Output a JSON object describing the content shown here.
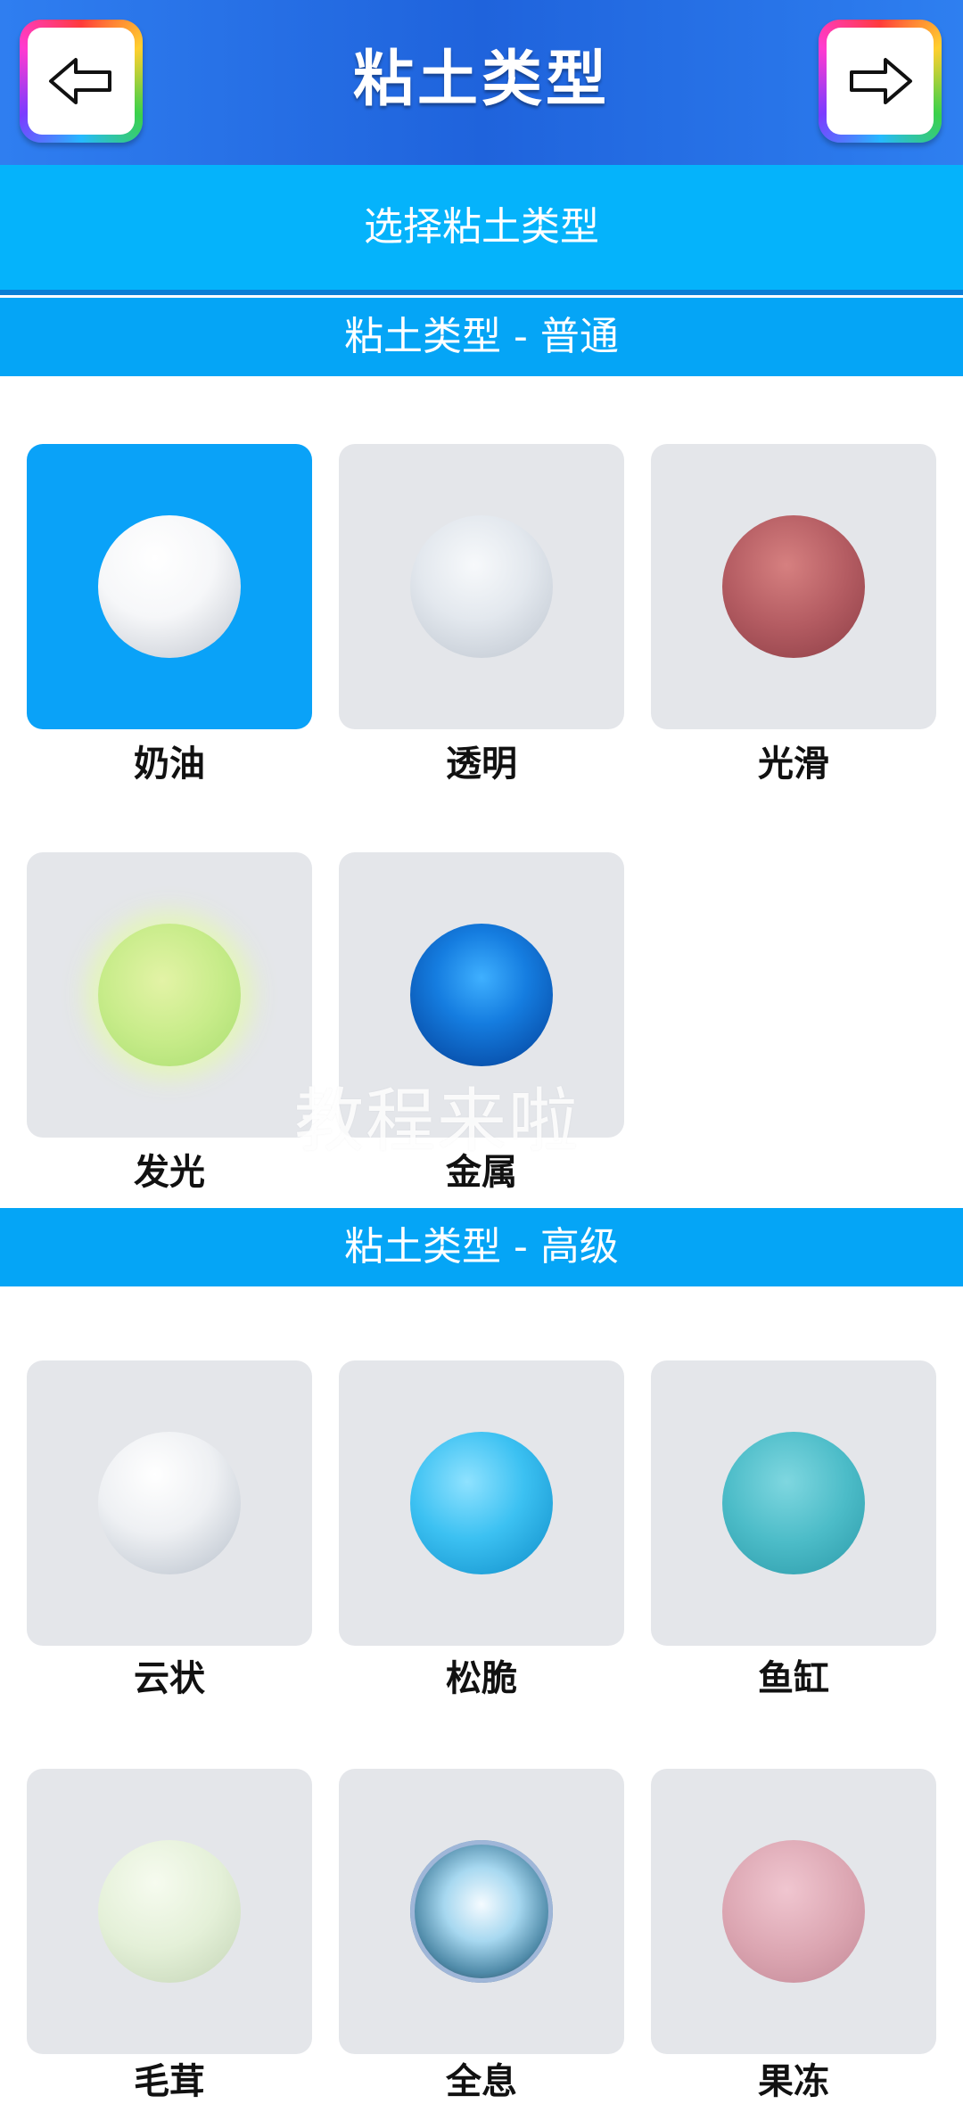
{
  "header": {
    "title": "粘土类型",
    "back_icon": "arrow-left-icon",
    "next_icon": "arrow-right-icon"
  },
  "subheader": {
    "label": "选择粘土类型"
  },
  "sections": {
    "basic": {
      "title": "粘土类型 - 普通",
      "items": [
        {
          "label": "奶油",
          "selected": true
        },
        {
          "label": "透明",
          "selected": false
        },
        {
          "label": "光滑",
          "selected": false
        },
        {
          "label": "发光",
          "selected": false
        },
        {
          "label": "金属",
          "selected": false
        }
      ]
    },
    "advanced": {
      "title": "粘土类型 - 高级",
      "items": [
        {
          "label": "云状"
        },
        {
          "label": "松脆"
        },
        {
          "label": "鱼缸"
        },
        {
          "label": "毛茸"
        },
        {
          "label": "全息"
        },
        {
          "label": "果冻"
        }
      ]
    }
  },
  "watermark": "教程来啦",
  "colors": {
    "topbar": "#2f7ef0",
    "subheader": "#05b3fb",
    "section_bar": "#05a5f6",
    "selected_tile": "#0aa2f8",
    "tile": "#e4e6ea"
  }
}
